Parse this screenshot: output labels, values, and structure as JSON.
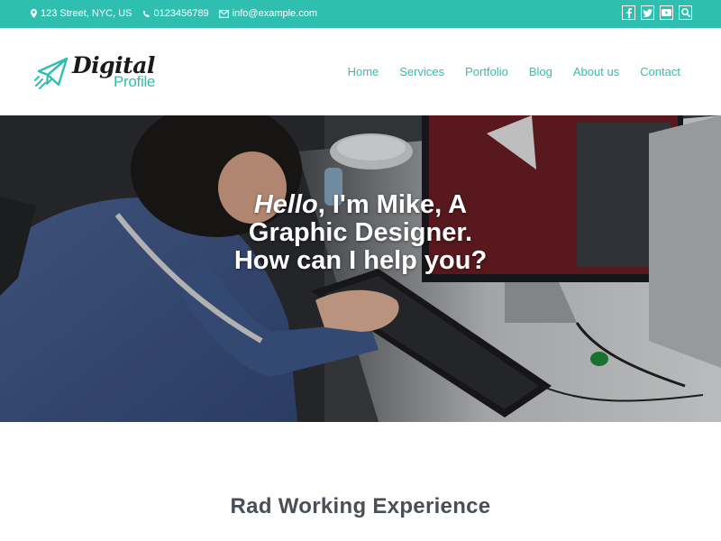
{
  "topbar": {
    "address": "123 Street, NYC, US",
    "phone": "0123456789",
    "email": "info@example.com",
    "social": [
      "facebook-icon",
      "twitter-icon",
      "youtube-icon",
      "search-icon"
    ]
  },
  "brand": {
    "word": "Digital",
    "sub": "Profile",
    "accent_color": "#2fbfb0"
  },
  "nav": {
    "items": [
      "Home",
      "Services",
      "Portfolio",
      "Blog",
      "About us",
      "Contact"
    ]
  },
  "hero": {
    "greeting": "Hello",
    "line1_rest": ", I'm Mike, A",
    "line2": "Graphic Designer.",
    "line3": "How can I help you?"
  },
  "section": {
    "title": "Rad Working Experience"
  }
}
